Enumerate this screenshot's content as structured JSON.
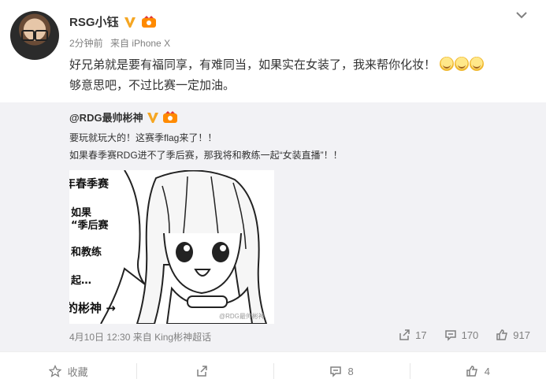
{
  "post": {
    "username": "RSG小钰",
    "time": "2分钟前",
    "source": "来自 iPhone X",
    "text_line1": "好兄弟就是要有福同享，有难同当，如果实在女装了，我来帮你化妆！",
    "text_line2": "够意思吧，不过比赛一定加油。"
  },
  "repost": {
    "username": "@RDG最帅彬神",
    "line1": "要玩就玩大的！这赛季flag来了！！",
    "line2": "如果春季赛RDG进不了季后赛，那我将和教练一起“女装直播”！！",
    "image_text": {
      "t1": "年春季赛",
      "t2": "如果",
      "t3": "“季后赛",
      "t4": "和教练",
      "t5": "起…",
      "t6": "的彬神 →",
      "watermark": "@RDG最帅彬神"
    },
    "meta_time": "4月10日 12:30",
    "meta_source": "来自 King彬神超话",
    "share_count": "17",
    "comment_count": "170",
    "like_count": "917"
  },
  "bottom_bar": {
    "favorite_label": "收藏",
    "share_label": "",
    "comment_count": "8",
    "like_count": "4"
  },
  "colors": {
    "text": "#333333",
    "muted": "#808080",
    "repost_bg": "#f2f2f5",
    "verified_gold": "#f5a623"
  }
}
